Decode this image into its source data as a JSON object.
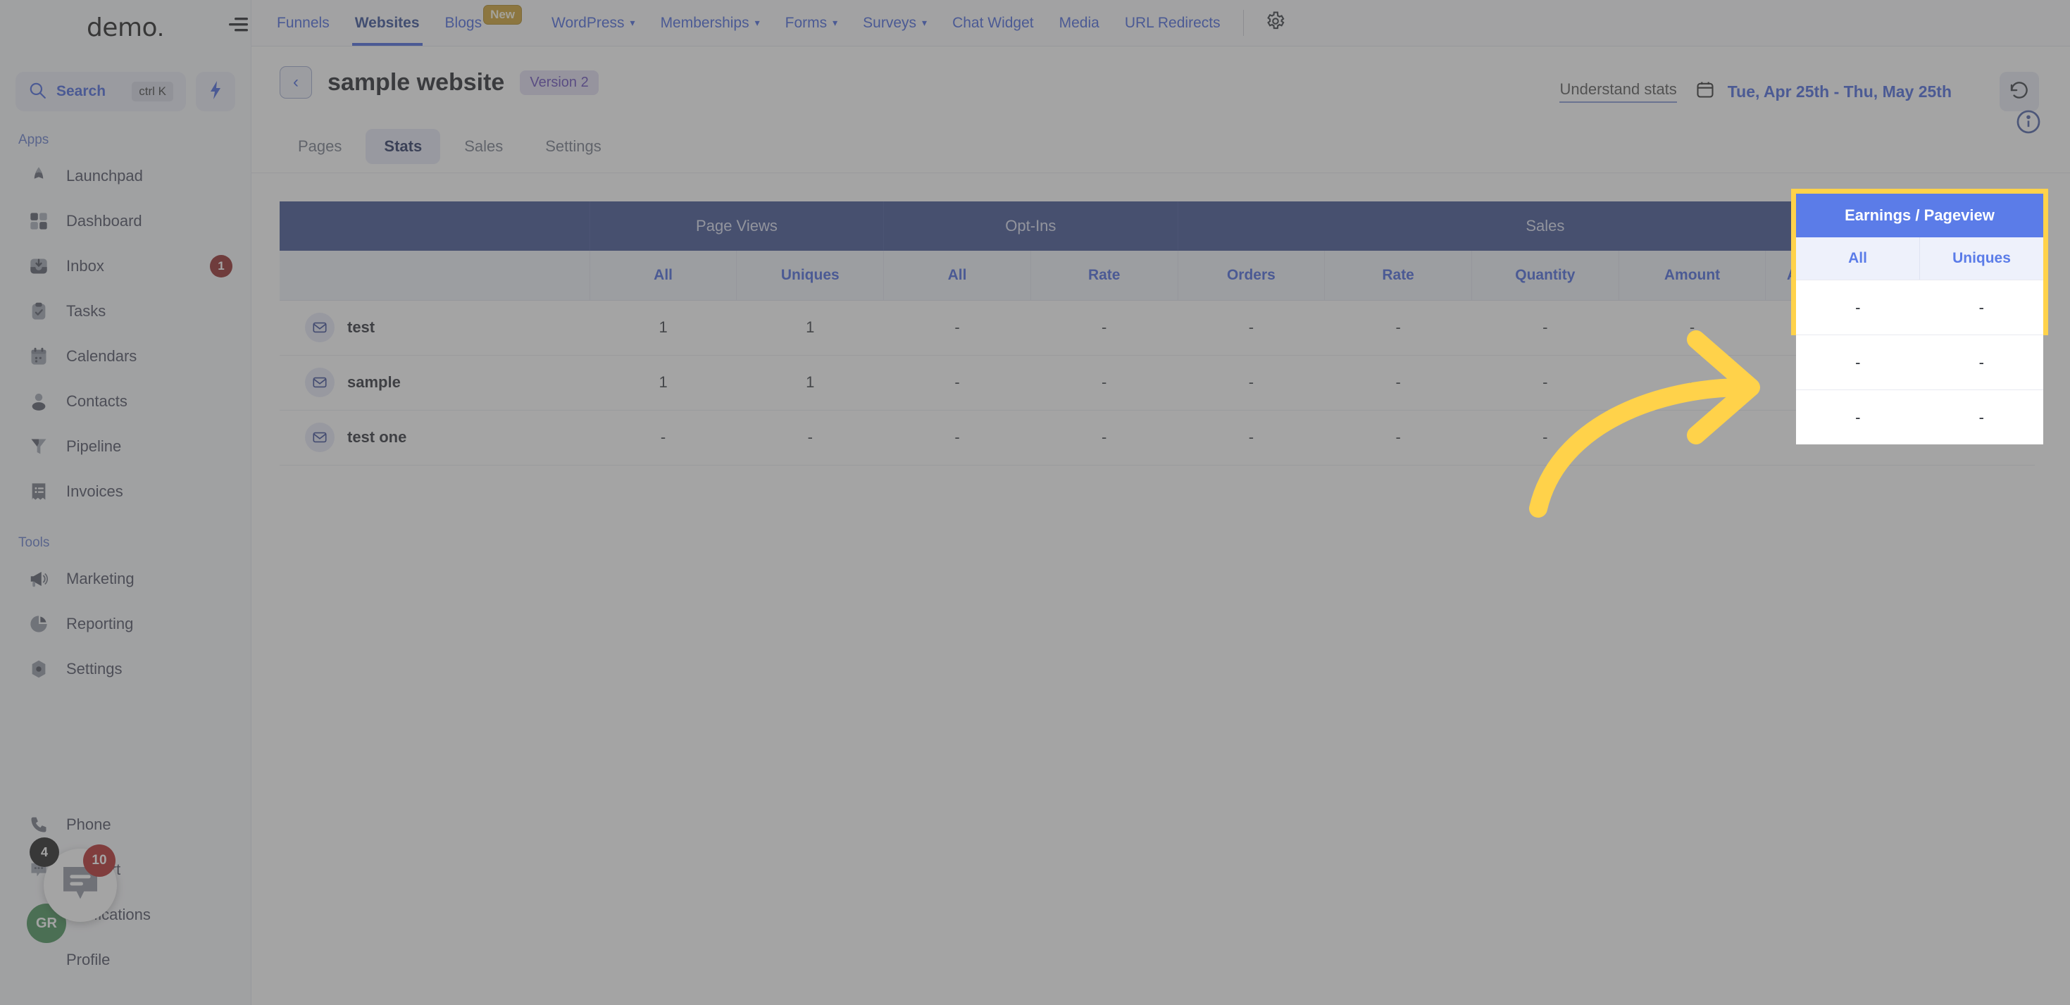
{
  "sidebar": {
    "brand": "demo",
    "brand_suffix": ".",
    "search": {
      "label": "Search",
      "shortcut": "ctrl K",
      "icon": "search-icon"
    },
    "quick_action_icon": "lightning-bolt-icon",
    "groups": [
      {
        "label": "Apps",
        "items": [
          {
            "label": "Launchpad",
            "icon": "rocket-icon",
            "badge": ""
          },
          {
            "label": "Dashboard",
            "icon": "grid-icon",
            "badge": ""
          },
          {
            "label": "Inbox",
            "icon": "inbox-icon",
            "badge": "1"
          },
          {
            "label": "Tasks",
            "icon": "clipboard-check-icon",
            "badge": ""
          },
          {
            "label": "Calendars",
            "icon": "calendar-icon",
            "badge": ""
          },
          {
            "label": "Contacts",
            "icon": "user-icon",
            "badge": ""
          },
          {
            "label": "Pipeline",
            "icon": "funnel-icon",
            "badge": ""
          },
          {
            "label": "Invoices",
            "icon": "receipt-icon",
            "badge": ""
          }
        ]
      },
      {
        "label": "Tools",
        "items": [
          {
            "label": "Marketing",
            "icon": "megaphone-icon",
            "badge": ""
          },
          {
            "label": "Reporting",
            "icon": "pie-chart-icon",
            "badge": ""
          },
          {
            "label": "Settings",
            "icon": "gear-icon",
            "badge": ""
          }
        ]
      }
    ],
    "bottom_items": [
      {
        "label": "Phone",
        "icon": "phone-icon",
        "badge": ""
      },
      {
        "label": "Support",
        "icon": "chat-dots-icon",
        "badge": ""
      },
      {
        "label": "Notifications",
        "icon": "bell-icon",
        "badge": ""
      },
      {
        "label": "Profile",
        "icon": "avatar-icon",
        "badge": ""
      }
    ],
    "avatar_initials": "GR",
    "fab": {
      "icon": "chat-bubble-icon",
      "badge_dark": "4",
      "badge_red": "10"
    }
  },
  "topnav": {
    "menu_icon": "hamburger-menu-icon",
    "items": [
      {
        "label": "Funnels",
        "active": false,
        "dropdown": false,
        "pill": ""
      },
      {
        "label": "Websites",
        "active": true,
        "dropdown": false,
        "pill": ""
      },
      {
        "label": "Blogs",
        "active": false,
        "dropdown": false,
        "pill": "New"
      },
      {
        "label": "WordPress",
        "active": false,
        "dropdown": true,
        "pill": ""
      },
      {
        "label": "Memberships",
        "active": false,
        "dropdown": true,
        "pill": ""
      },
      {
        "label": "Forms",
        "active": false,
        "dropdown": true,
        "pill": ""
      },
      {
        "label": "Surveys",
        "active": false,
        "dropdown": true,
        "pill": ""
      },
      {
        "label": "Chat Widget",
        "active": false,
        "dropdown": false,
        "pill": ""
      },
      {
        "label": "Media",
        "active": false,
        "dropdown": false,
        "pill": ""
      },
      {
        "label": "URL Redirects",
        "active": false,
        "dropdown": false,
        "pill": ""
      }
    ],
    "settings_icon": "gear-icon"
  },
  "header": {
    "back_icon": "chevron-left-icon",
    "title": "sample website",
    "version_badge": "Version 2",
    "understand_stats": "Understand stats",
    "calendar_icon": "calendar-icon",
    "date_range": "Tue, Apr 25th - Thu, May 25th",
    "refresh_icon": "refresh-icon",
    "info_icon": "info-icon"
  },
  "tabs": [
    {
      "label": "Pages",
      "active": false
    },
    {
      "label": "Stats",
      "active": true
    },
    {
      "label": "Sales",
      "active": false
    },
    {
      "label": "Settings",
      "active": false
    }
  ],
  "table": {
    "group_headers": [
      {
        "label": "",
        "span": 1
      },
      {
        "label": "Page Views",
        "span": 2
      },
      {
        "label": "Opt-Ins",
        "span": 2
      },
      {
        "label": "Sales",
        "span": 5
      },
      {
        "label": "",
        "span": 1
      }
    ],
    "sub_headers": [
      "",
      "All",
      "Uniques",
      "All",
      "Rate",
      "Orders",
      "Rate",
      "Quantity",
      "Amount",
      "Avg. cart value",
      ""
    ],
    "rows": [
      {
        "icon": "mail-icon",
        "name": "test",
        "values": [
          "1",
          "1",
          "-",
          "-",
          "-",
          "-",
          "-",
          "-",
          "-",
          "-"
        ]
      },
      {
        "icon": "mail-icon",
        "name": "sample",
        "values": [
          "1",
          "1",
          "-",
          "-",
          "-",
          "-",
          "-",
          "-",
          "-",
          "-"
        ]
      },
      {
        "icon": "mail-icon",
        "name": "test one",
        "values": [
          "-",
          "-",
          "-",
          "-",
          "-",
          "-",
          "-",
          "-",
          "-",
          "-"
        ]
      }
    ]
  },
  "highlight": {
    "title": "Earnings / Pageview",
    "sub_headers": [
      "All",
      "Uniques"
    ],
    "rows": [
      [
        "-",
        "-"
      ],
      [
        "-",
        "-"
      ],
      [
        "-",
        "-"
      ]
    ],
    "border_color": "#ffd24a",
    "header_color": "#5b7ce8"
  },
  "annotation": {
    "arrow_color": "#ffd24a",
    "arrow_direction": "right"
  }
}
